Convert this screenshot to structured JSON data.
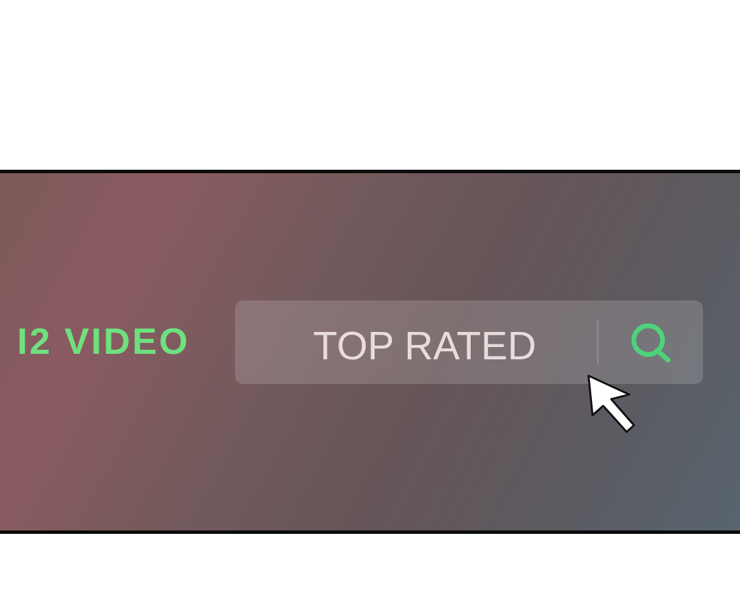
{
  "panel": {
    "logo": "I2 VIDEO",
    "search": {
      "value": "TOP RATED"
    }
  }
}
